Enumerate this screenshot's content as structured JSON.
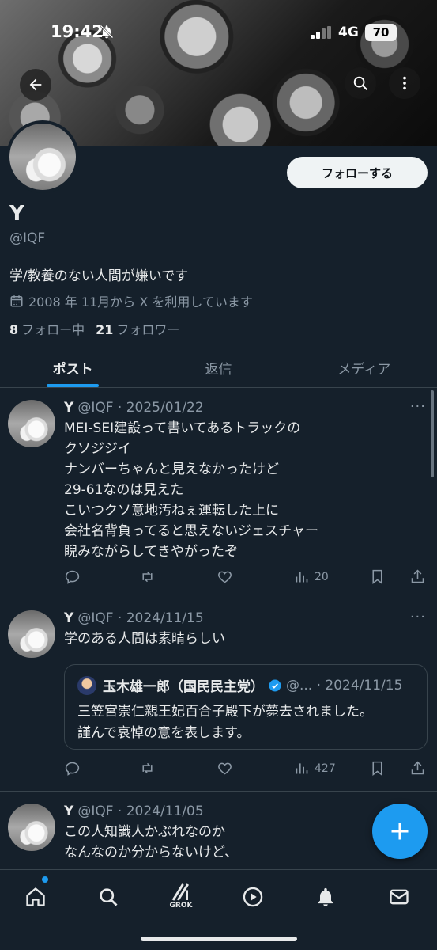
{
  "status_bar": {
    "time": "19:42",
    "network": "4G",
    "battery": "70"
  },
  "profile": {
    "follow_label": "フォローする",
    "name": "Y",
    "handle": "@IQF",
    "bio": "学/教養のない人間が嫌いです",
    "joined": "2008 年 11月から X を利用しています",
    "following_count": "8",
    "following_label": "フォロー中",
    "followers_count": "21",
    "followers_label": "フォロワー"
  },
  "tabs": [
    {
      "label": "ポスト",
      "active": true
    },
    {
      "label": "返信",
      "active": false
    },
    {
      "label": "メディア",
      "active": false
    }
  ],
  "tweets": [
    {
      "name": "Y",
      "meta": "@IQF · 2025/01/22",
      "text": "MEI-SEI建設って書いてあるトラックの\nクソジジイ\nナンバーちゃんと見えなかったけど\n29-61なのは見えた\nこいつクソ意地汚ねぇ運転した上に\n会社名背負ってると思えないジェスチャー\n睨みながらしてきやがったぞ",
      "views": "20"
    },
    {
      "name": "Y",
      "meta": "@IQF · 2024/11/15",
      "text": "学のある人間は素晴らしい",
      "views": "427",
      "quote": {
        "name": "玉木雄一郎（国民民主党）",
        "meta": "@... · 2024/11/15",
        "text": "三笠宮崇仁親王妃百合子殿下が薨去されました。\n謹んで哀悼の意を表します。"
      }
    },
    {
      "name": "Y",
      "meta": "@IQF · 2024/11/05",
      "text": "この人知識人かぶれなのか\nなんなのか分からないけど、"
    }
  ],
  "nav": {
    "grok_label": "GROK"
  },
  "colors": {
    "accent": "#1d9bf0",
    "background": "#15202b",
    "border": "#38444d",
    "muted": "#8b98a5"
  }
}
